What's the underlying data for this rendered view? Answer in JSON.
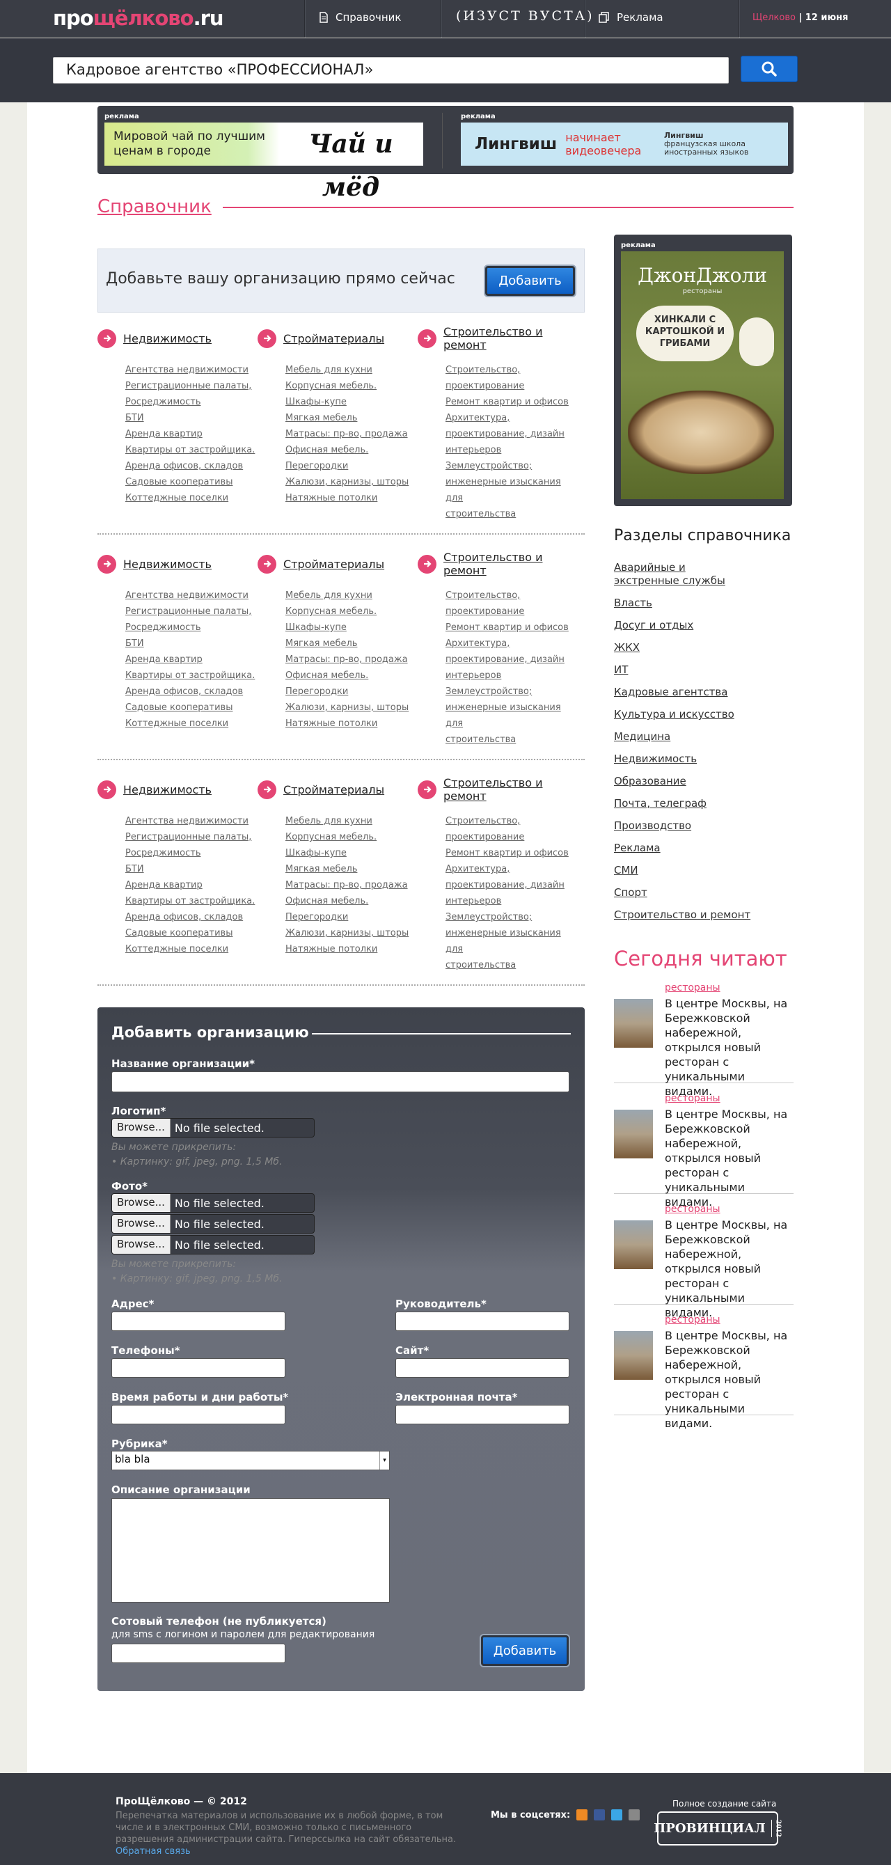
{
  "header": {
    "logo_a": "про",
    "logo_b": "щёлково",
    "logo_c": ".ru",
    "nav_directory": "Справочник",
    "brand": "(ИЗУСТ ВУСТА)",
    "nav_ads": "Реклама",
    "city": "Щелково",
    "date": "| 12 июня"
  },
  "search": {
    "value": "Кадровое агентство «ПРОФЕССИОНАЛ»"
  },
  "ads": {
    "label": "реклама",
    "ad1_text": "Мировой чай по лучшим ценам в городе",
    "ad1_brand": "Чай и мёд",
    "ad2_brand": "Лингвиш",
    "ad2_text": "начинает видеовечера",
    "ad2_logo": "Лингвиш",
    "ad2_sub": "французская школа иностранных языков"
  },
  "page_title": "Справочник",
  "cta": {
    "text": "Добавьте вашу организацию прямо сейчас",
    "button": "Добавить"
  },
  "categories": [
    {
      "title": "Недвижимость",
      "items": [
        "Агентства недвижимости",
        "Регистрационные палаты,",
        "Росреджимость",
        "БТИ",
        "Аренда квартир",
        "Квартиры от застройщика.",
        "Аренда офисов, складов",
        "Садовые кооперативы",
        "Коттеджные поселки"
      ]
    },
    {
      "title": "Стройматериалы",
      "items": [
        "Мебель для кухни",
        "Корпусная мебель.",
        "Шкафы-купе",
        "Мягкая мебель",
        "Матрасы: пр-во, продажа",
        "Офисная мебель.",
        "Перегородки",
        "Жалюзи, карнизы, шторы",
        "Натяжные потолки"
      ]
    },
    {
      "title": "Строительство и ремонт",
      "items": [
        "Строительство,",
        "проектирование",
        "Ремонт квартир и офисов",
        "Архитектура,",
        "проектирование, дизайн",
        "интерьеров",
        "Землеустройство;",
        "инженерные изыскания для",
        "строительства"
      ]
    }
  ],
  "form": {
    "title": "Добавить организацию",
    "name_label": "Название организации*",
    "logo_label": "Логотип*",
    "file_button": "Browse...",
    "file_none": "No file selected.",
    "hint1": "Вы можете прикрепить:",
    "hint2": "• Картинку: gif, jpeg, png. 1,5 Мб.",
    "photo_label": "Фото*",
    "address_label": "Адрес*",
    "head_label": "Руководитель*",
    "phones_label": "Телефоны*",
    "site_label": "Сайт*",
    "hours_label": "Время работы и дни работы*",
    "email_label": "Электронная почта*",
    "rubric_label": "Рубрика*",
    "rubric_value": "bla bla",
    "desc_label": "Описание организации",
    "mobile_label": "Сотовый телефон (не публикуется)",
    "mobile_sub": "для sms с логином и паролем для редактирования",
    "submit": "Добавить"
  },
  "sidebar": {
    "ad_label": "реклама",
    "ad_brand": "ДжонДжоли",
    "ad_sub": "рестораны",
    "ad_slogan": "ХИНКАЛИ С КАРТОШКОЙ И ГРИБАМИ",
    "sections_title": "Разделы справочника",
    "sections": [
      "Аварийные и экстренные службы",
      "Власть",
      "Досуг и отдых",
      "ЖКХ",
      "ИТ",
      "Кадровые агентства",
      "Культура и искусство",
      "Медицина",
      "Недвижимость",
      "Образование",
      "Почта, телеграф",
      "Производство",
      "Реклама",
      "СМИ",
      "Спорт",
      "Строительство и ремонт"
    ],
    "reading_title": "Сегодня читают",
    "news": [
      {
        "category": "рестораны",
        "text": "В центре Москвы, на Бережковской набережной, открылся новый ресторан с уникальными видами."
      },
      {
        "category": "рестораны",
        "text": "В центре Москвы, на Бережковской набережной, открылся новый ресторан с уникальными видами."
      },
      {
        "category": "рестораны",
        "text": "В центре Москвы, на Бережковской набережной, открылся новый ресторан с уникальными видами."
      },
      {
        "category": "рестораны",
        "text": "В центре Москвы, на Бережковской набережной, открылся новый ресторан с уникальными видами."
      }
    ]
  },
  "footer": {
    "copyright": "ПроЩёлково — © 2012",
    "disclaimer": "Перепечатка материалов и использование их в любой форме, в том числе и в электронных СМИ, возможно только с письменного разрешения администрации сайта. Гиперссылка на сайт обязательна.",
    "feedback": "Обратная связь",
    "social_label": "Мы в соцсетях:",
    "made_by": "Полное создание сайта",
    "agency": "ПРОВИНЦИАЛ",
    "agency_sub": "рекламное агентство",
    "agency_year": "2012"
  }
}
